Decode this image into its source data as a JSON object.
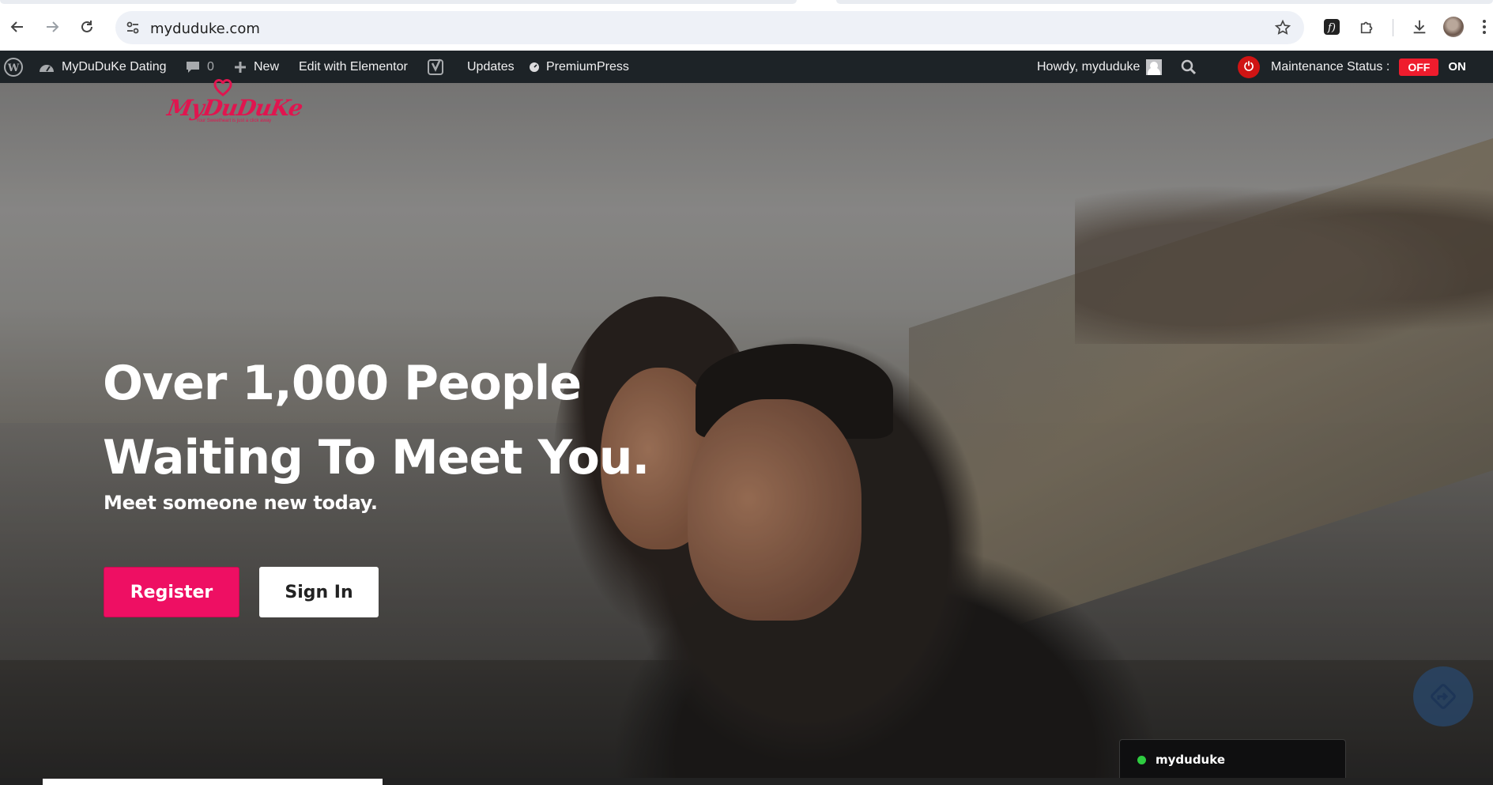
{
  "browser": {
    "url": "myduduke.com"
  },
  "adminbar": {
    "site_name": "MyDuDuKe Dating",
    "comments_count": "0",
    "new_label": "New",
    "elementor_label": "Edit with Elementor",
    "updates_label": "Updates",
    "premiumpress_label": "PremiumPress",
    "howdy": "Howdy, myduduke",
    "maintenance_label": "Maintenance Status :",
    "toggle_off": "OFF",
    "toggle_on": "ON"
  },
  "hero": {
    "logo_text": "MyDuDuKe",
    "logo_tagline": "Your Sweetheart is just a click away",
    "headline_line1": "Over 1,000 People",
    "headline_line2": "Waiting To Meet You.",
    "subheadline": "Meet someone new today.",
    "register_label": "Register",
    "signin_label": "Sign In"
  },
  "chat": {
    "username": "myduduke",
    "status_color": "#2ecc40"
  },
  "colors": {
    "accent": "#ee0f63",
    "adminbar_bg": "#1d2327",
    "maintenance_off": "#ef1c2d"
  }
}
